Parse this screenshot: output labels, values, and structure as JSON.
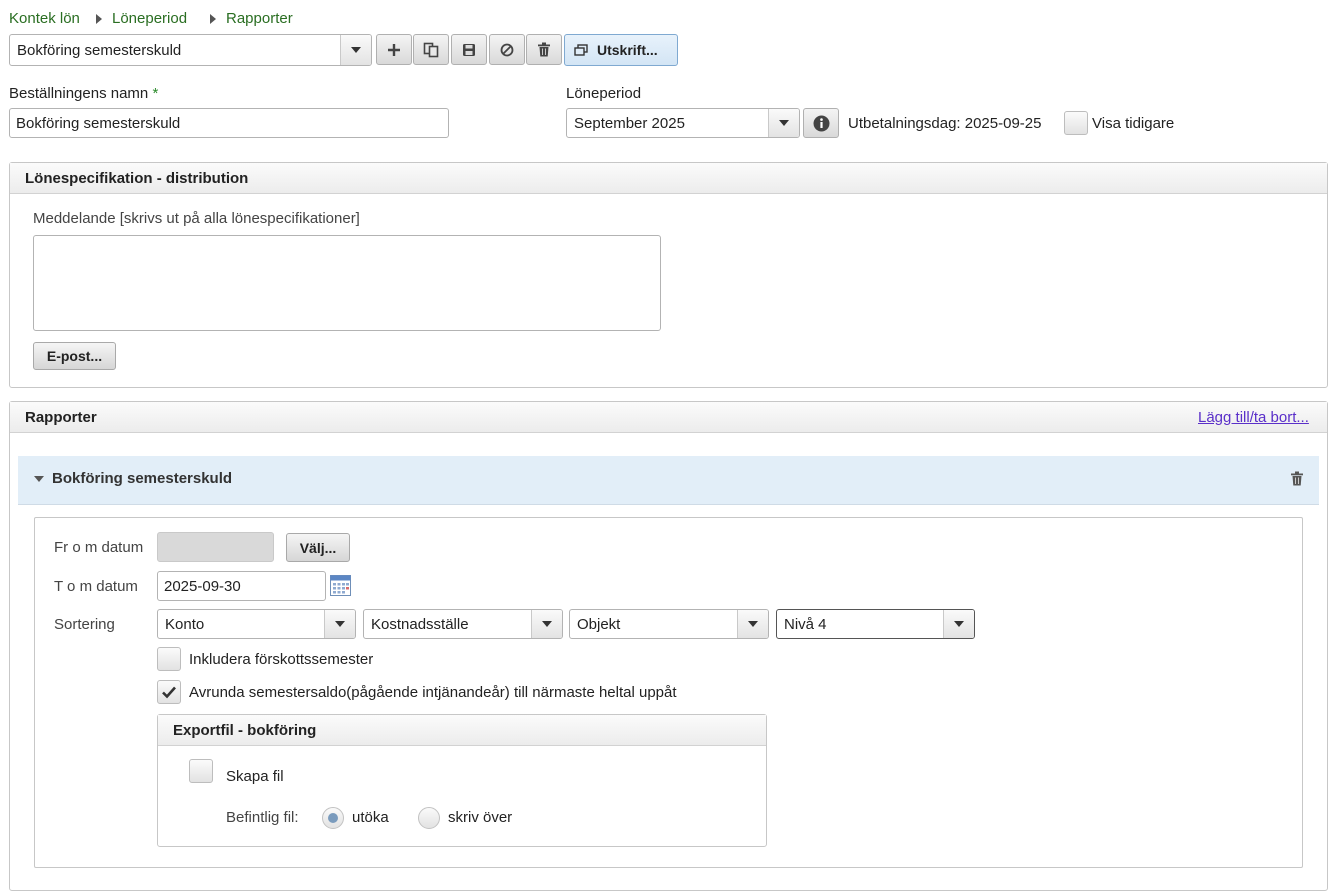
{
  "breadcrumb": [
    "Kontek lön",
    "Löneperiod",
    "Rapporter"
  ],
  "order_select": {
    "value": "Bokföring semesterskuld"
  },
  "toolbar": {
    "print_label": "Utskrift...",
    "icons": [
      "add-icon",
      "copy-icon",
      "save-icon",
      "cancel-icon",
      "delete-icon",
      "window-icon"
    ]
  },
  "order_name": {
    "label": "Beställningens namn",
    "required": "*",
    "value": "Bokföring semesterskuld"
  },
  "period": {
    "label": "Löneperiod",
    "value": "September 2025",
    "payday_text": "Utbetalningsdag: 2025-09-25",
    "show_earlier_label": "Visa tidigare"
  },
  "distribution": {
    "title": "Lönespecifikation - distribution",
    "message_label": "Meddelande [skrivs ut på alla lönespecifikationer]",
    "message_value": "",
    "email_button": "E-post..."
  },
  "reports": {
    "title": "Rapporter",
    "add_remove_link": "Lägg till/ta bort...",
    "item_title": "Bokföring semesterskuld",
    "from_label": "Fr o m datum",
    "from_value": "",
    "choose_button": "Välj...",
    "to_label": "T o m datum",
    "to_value": "2025-09-30",
    "sort_label": "Sortering",
    "sort_values": [
      "Konto",
      "Kostnadsställe",
      "Objekt",
      "Nivå 4"
    ],
    "include_advance_label": "Inkludera förskottssemester",
    "include_advance_checked": false,
    "round_label": "Avrunda semestersaldo(pågående intjänandeår) till närmaste heltal uppåt",
    "round_checked": true
  },
  "export": {
    "title": "Exportfil - bokföring",
    "create_file_label": "Skapa fil",
    "create_file_checked": false,
    "existing_file_label": "Befintlig fil:",
    "option_extend": "utöka",
    "option_overwrite": "skriv över",
    "selected": "utöka"
  },
  "colors": {
    "breadcrumb": "#2a6e22",
    "link": "#5a2fc9",
    "report_header_bg": "#e2eef8",
    "print_button_bg": "#dcebf8"
  }
}
